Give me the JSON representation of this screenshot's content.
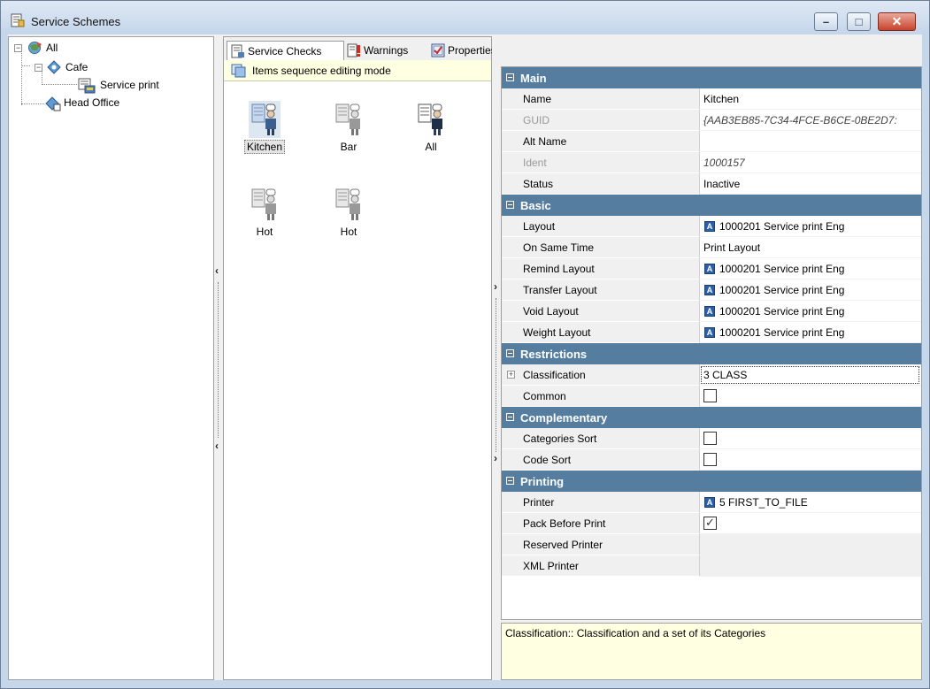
{
  "window": {
    "title": "Service Schemes"
  },
  "tree": {
    "nodes": [
      {
        "label": "All"
      },
      {
        "label": "Cafe"
      },
      {
        "label": "Service print"
      },
      {
        "label": "Head Office"
      }
    ]
  },
  "tabs": [
    {
      "label": "Service Checks"
    },
    {
      "label": "Warnings"
    },
    {
      "label": "Properties"
    }
  ],
  "mode_bar": {
    "label": "Items sequence editing mode"
  },
  "checks": [
    {
      "label": "Kitchen"
    },
    {
      "label": "Bar"
    },
    {
      "label": "All"
    },
    {
      "label": "Hot"
    },
    {
      "label": "Hot"
    }
  ],
  "property_grid": {
    "categories": {
      "main": "Main",
      "basic": "Basic",
      "restrictions": "Restrictions",
      "complementary": "Complementary",
      "printing": "Printing"
    },
    "main": {
      "name": {
        "label": "Name",
        "value": "Kitchen"
      },
      "guid": {
        "label": "GUID",
        "value": "{AAB3EB85-7C34-4FCE-B6CE-0BE2D7:"
      },
      "alt_name": {
        "label": "Alt Name",
        "value": ""
      },
      "ident": {
        "label": "Ident",
        "value": "1000157"
      },
      "status": {
        "label": "Status",
        "value": "Inactive"
      }
    },
    "basic": {
      "layout": {
        "label": "Layout",
        "value": "1000201 Service print Eng"
      },
      "on_same_time": {
        "label": "On Same Time",
        "value": "Print Layout"
      },
      "remind_layout": {
        "label": "Remind Layout",
        "value": "1000201 Service print Eng"
      },
      "transfer_layout": {
        "label": "Transfer Layout",
        "value": "1000201 Service print Eng"
      },
      "void_layout": {
        "label": "Void Layout",
        "value": "1000201 Service print Eng"
      },
      "weight_layout": {
        "label": "Weight Layout",
        "value": "1000201 Service print Eng"
      }
    },
    "restrictions": {
      "classification": {
        "label": "Classification",
        "value": "3 CLASS"
      },
      "common": {
        "label": "Common",
        "checked": false
      }
    },
    "complementary": {
      "categories_sort": {
        "label": "Categories Sort",
        "checked": false
      },
      "code_sort": {
        "label": "Code Sort",
        "checked": false
      }
    },
    "printing": {
      "printer": {
        "label": "Printer",
        "value": "5 FIRST_TO_FILE"
      },
      "pack_before_print": {
        "label": "Pack Before Print",
        "checked": true
      },
      "reserved_printer": {
        "label": "Reserved Printer",
        "value": ""
      },
      "xml_printer": {
        "label": "XML Printer",
        "value": ""
      }
    }
  },
  "description": {
    "text": "Classification:: Classification and a set of its Categories"
  },
  "icons": {
    "layout_ref": "A",
    "expand": "+",
    "collapse": "−"
  },
  "colors": {
    "category_header": "#557d9f",
    "info_background": "#ffffe1"
  }
}
